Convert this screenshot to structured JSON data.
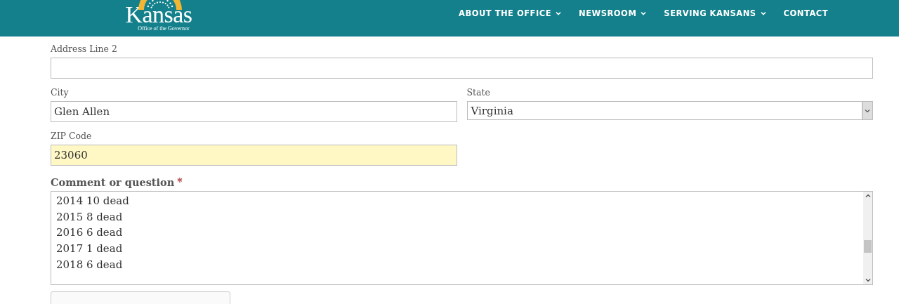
{
  "header": {
    "logo": {
      "name": "Kansas",
      "subtitle": "Office of the Governor"
    },
    "nav": [
      {
        "label": "ABOUT THE OFFICE",
        "dropdown": true
      },
      {
        "label": "NEWSROOM",
        "dropdown": true
      },
      {
        "label": "SERVING KANSANS",
        "dropdown": true
      },
      {
        "label": "CONTACT",
        "dropdown": false
      }
    ]
  },
  "form": {
    "address_line_2": {
      "label": "Address Line 2"
    },
    "city": {
      "label": "City",
      "value": "Glen Allen"
    },
    "state": {
      "label": "State",
      "value": "Virginia"
    },
    "zip": {
      "label": "ZIP Code",
      "value": "23060",
      "autofilled": true
    },
    "comment": {
      "label": "Comment or question",
      "required_mark": "*",
      "lines": [
        "2014 10 dead",
        "2015 8 dead",
        "2016 6 dead",
        "2017 1 dead",
        "2018 6 dead"
      ]
    }
  }
}
